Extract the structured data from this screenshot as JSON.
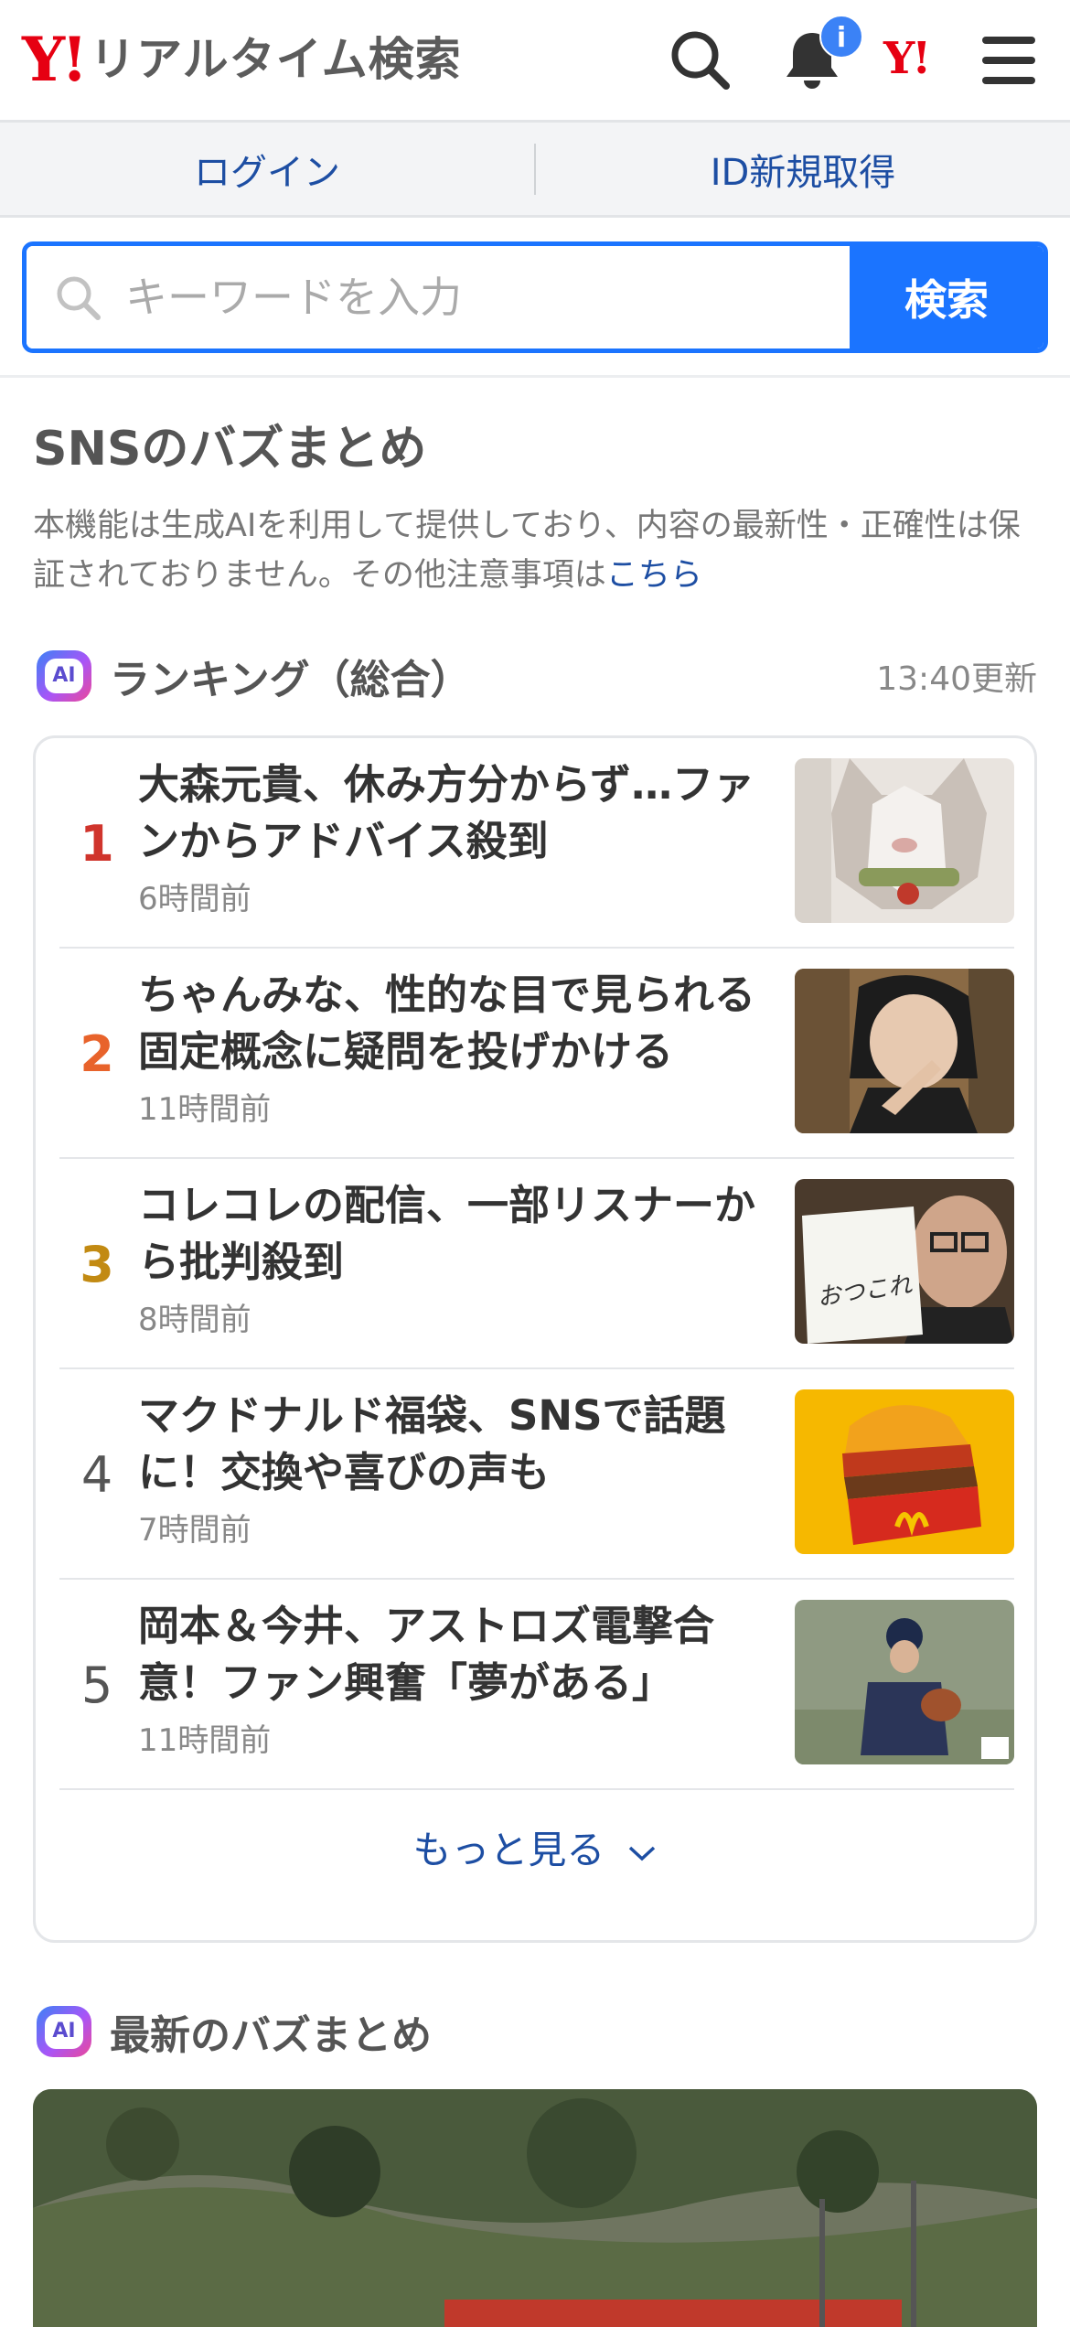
{
  "header": {
    "logo_mark": "Y!",
    "logo_text": "リアルタイム検索",
    "notification_badge": "i",
    "yahoo_mark": "Y!"
  },
  "auth": {
    "login": "ログイン",
    "register": "ID新規取得"
  },
  "search": {
    "placeholder": "キーワードを入力",
    "button": "検索"
  },
  "buzz": {
    "title": "SNSのバズまとめ",
    "disclaimer": "本機能は生成AIを利用して提供しており、内容の最新性・正確性は保証されておりません。その他注意事項は",
    "disclaimer_link": "こちら"
  },
  "ranking": {
    "ai_badge": "AI",
    "title": "ランキング（総合）",
    "updated": "13:40更新",
    "items": [
      {
        "rank": "1",
        "title": "大森元貴、休み方分からず…ファンからアドバイス殺到",
        "time": "6時間前"
      },
      {
        "rank": "2",
        "title": "ちゃんみな、性的な目で見られる固定概念に疑問を投げかける",
        "time": "11時間前"
      },
      {
        "rank": "3",
        "title": "コレコレの配信、一部リスナーから批判殺到",
        "time": "8時間前"
      },
      {
        "rank": "4",
        "title": "マクドナルド福袋、SNSで話題に！交換や喜びの声も",
        "time": "7時間前"
      },
      {
        "rank": "5",
        "title": "岡本＆今井、アストロズ電撃合意！ファン興奮「夢がある」",
        "time": "11時間前"
      }
    ],
    "more": "もっと見る"
  },
  "latest": {
    "ai_badge": "AI",
    "title": "最新のバズまとめ"
  },
  "colors": {
    "rank1": "#d0342c",
    "rank2": "#e8632b",
    "rank3": "#c28a12",
    "rank_other": "#555555",
    "accent": "#1b74ff",
    "link": "#1d4ea3",
    "brand": "#e60012"
  },
  "thumbnails": {
    "note_text": "おつこれ"
  }
}
